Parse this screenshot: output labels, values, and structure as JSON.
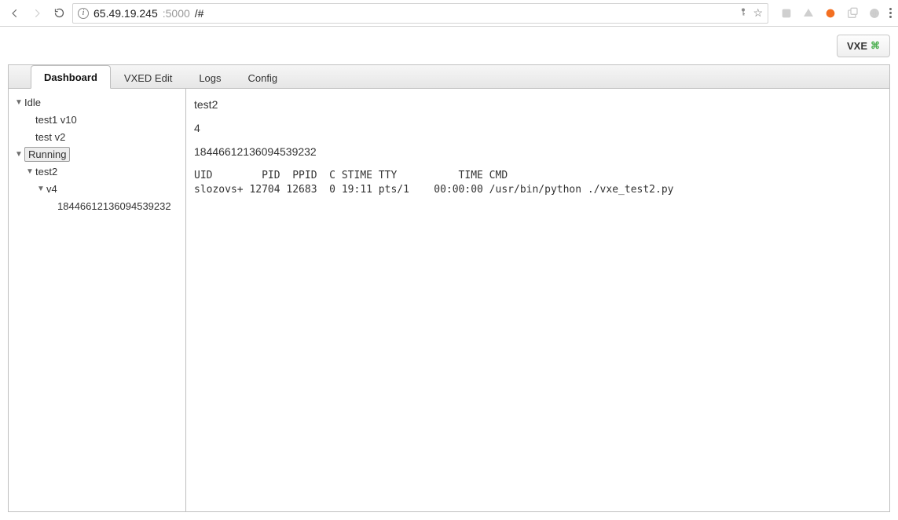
{
  "browser": {
    "url_host": "65.49.19.245",
    "url_port": ":5000",
    "url_path": "/#"
  },
  "header_button": {
    "label": "VXE",
    "suffix": "⌘"
  },
  "tabs": [
    "Dashboard",
    "VXED Edit",
    "Logs",
    "Config"
  ],
  "active_tab": "Dashboard",
  "tree": {
    "idle": {
      "label": "Idle",
      "children": [
        "test1 v10",
        "test v2"
      ]
    },
    "running": {
      "label": "Running",
      "selected": true,
      "children": [
        {
          "label": "test2",
          "children": [
            {
              "label": "v4",
              "children": [
                "18446612136094539232"
              ]
            }
          ]
        }
      ]
    }
  },
  "main": {
    "line1": "test2",
    "line2": "4",
    "line3": "18446612136094539232",
    "ps_text": "UID        PID  PPID  C STIME TTY          TIME CMD\nslozovs+ 12704 12683  0 19:11 pts/1    00:00:00 /usr/bin/python ./vxe_test2.py"
  }
}
